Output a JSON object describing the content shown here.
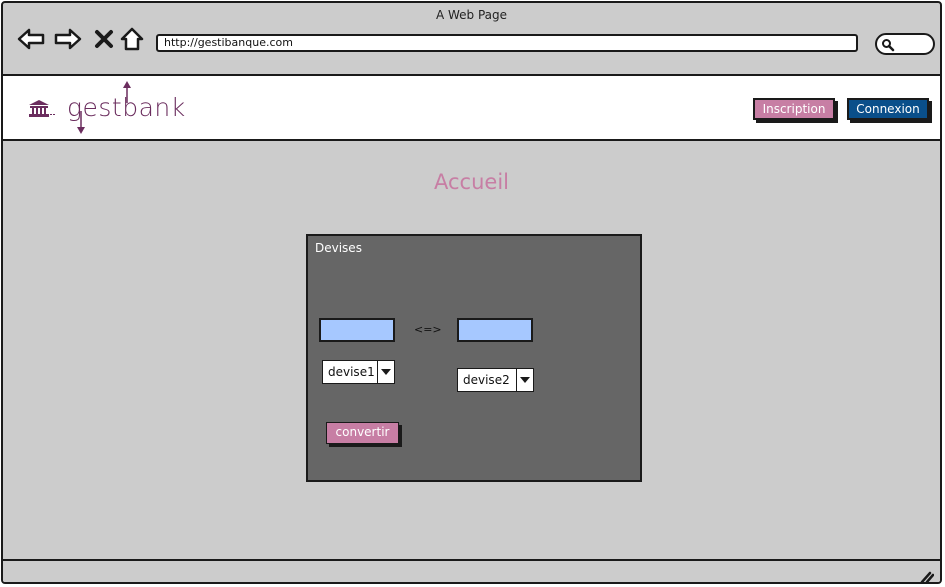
{
  "browser": {
    "window_title": "A Web Page",
    "url": "http://gestibanque.com",
    "icons": {
      "back": "back-arrow-icon",
      "forward": "forward-arrow-icon",
      "stop": "close-icon",
      "home": "home-icon",
      "search": "search-icon"
    }
  },
  "header": {
    "logo_text": "gestbank",
    "buttons": {
      "inscription": "Inscription",
      "connexion": "Connexion"
    }
  },
  "page": {
    "heading": "Accueil"
  },
  "converter": {
    "title": "Devises",
    "swap_symbol": "<=>",
    "amount_left": "",
    "amount_right": "",
    "currency_left": "devise1",
    "currency_right": "devise2",
    "convert_label": "convertir"
  },
  "colors": {
    "accent_pink": "#c77ea4",
    "accent_blue": "#0a4f8a",
    "logo_purple": "#6b2d5e",
    "input_blue": "#a6c8ff",
    "panel_gray": "#666666",
    "page_gray": "#cccccc"
  }
}
